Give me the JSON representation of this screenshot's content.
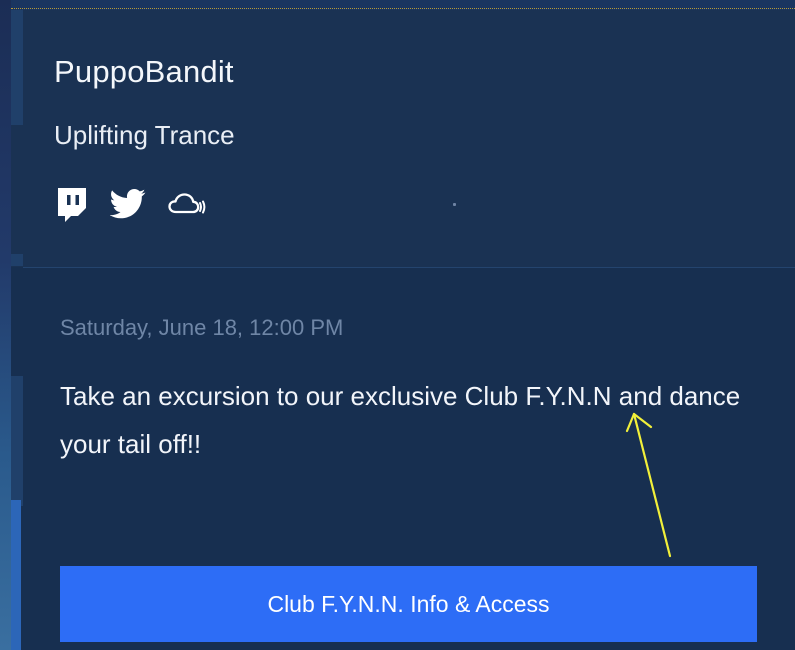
{
  "card": {
    "artist_name": "PuppoBandit",
    "genre": "Uplifting Trance",
    "socials": [
      {
        "name": "twitch",
        "icon": "twitch-icon"
      },
      {
        "name": "twitter",
        "icon": "twitter-icon"
      },
      {
        "name": "mixcloud",
        "icon": "mixcloud-icon"
      }
    ],
    "event_date": "Saturday, June 18, 12:00 PM",
    "description": "Take an excursion to our exclusive Club F.Y.N.N and dance your tail off!!",
    "cta_label": "Club F.Y.N.N. Info & Access"
  },
  "colors": {
    "card_bg": "#172f50",
    "header_bg": "#1a3253",
    "date_text": "#6f86a6",
    "cta_bg": "#2d6df6",
    "annotation_arrow": "#f2f03a"
  }
}
